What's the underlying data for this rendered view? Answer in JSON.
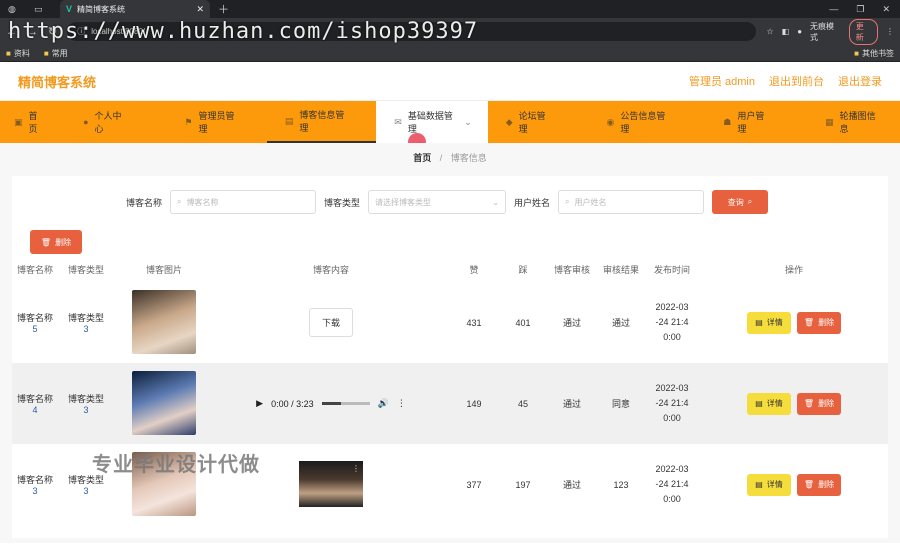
{
  "browser": {
    "tab_title": "精简博客系统",
    "url": "localhost:8080/",
    "incognito_label": "无痕模式",
    "update_label": "更新",
    "bookmarks": [
      "资料",
      "常用"
    ],
    "other_bookmarks": "其他书签",
    "watermark": "https://www.huzhan.com/ishop39397"
  },
  "app": {
    "brand": "精简博客系统",
    "admin_label": "管理员 admin",
    "back_label": "退出到前台",
    "logout_label": "退出登录"
  },
  "menu": [
    {
      "label": "首页",
      "icon": "home-icon"
    },
    {
      "label": "个人中心",
      "icon": "user-icon"
    },
    {
      "label": "管理员管理",
      "icon": "flag-icon"
    },
    {
      "label": "博客信息管理",
      "icon": "doc-icon"
    },
    {
      "label": "基础数据管理",
      "icon": "mail-icon"
    },
    {
      "label": "论坛管理",
      "icon": "forum-icon"
    },
    {
      "label": "公告信息管理",
      "icon": "notice-icon"
    },
    {
      "label": "用户管理",
      "icon": "users-icon"
    },
    {
      "label": "轮播图信息",
      "icon": "image-icon"
    }
  ],
  "breadcrumb": {
    "home": "首页",
    "sep": "/",
    "current": "博客信息"
  },
  "filters": {
    "name_label": "博客名称",
    "name_placeholder": "博客名称",
    "type_label": "博客类型",
    "type_placeholder": "请选择博客类型",
    "user_label": "用户姓名",
    "user_placeholder": "用户姓名",
    "query_label": "查询",
    "delete_label": "删除"
  },
  "table": {
    "headers": [
      "博客名称",
      "博客类型",
      "博客图片",
      "博客内容",
      "赞",
      "踩",
      "博客审核",
      "审核结果",
      "发布时间",
      "操作"
    ],
    "rows": [
      {
        "name": "博客名称",
        "name_num": "5",
        "type": "博客类型",
        "type_num": "3",
        "content": "下载",
        "likes": "431",
        "dislikes": "401",
        "audit": "通过",
        "result": "通过",
        "time1": "2022-03",
        "time2": "-24 21:4",
        "time3": "0:00"
      },
      {
        "name": "博客名称",
        "name_num": "4",
        "type": "博客类型",
        "type_num": "3",
        "content": "0:00 / 3:23",
        "likes": "149",
        "dislikes": "45",
        "audit": "通过",
        "result": "同意",
        "time1": "2022-03",
        "time2": "-24 21:4",
        "time3": "0:00"
      },
      {
        "name": "博客名称",
        "name_num": "3",
        "type": "博客类型",
        "type_num": "3",
        "content": "",
        "likes": "377",
        "dislikes": "197",
        "audit": "通过",
        "result": "123",
        "time1": "2022-03",
        "time2": "-24 21:4",
        "time3": "0:00"
      }
    ],
    "detail_label": "详情",
    "remove_label": "删除"
  },
  "overlay_text": "专业毕业设计代做",
  "colors": {
    "brand": "#f39a20",
    "menu": "#fd9a0c",
    "danger": "#e8613f",
    "detail": "#f5dd3b"
  }
}
